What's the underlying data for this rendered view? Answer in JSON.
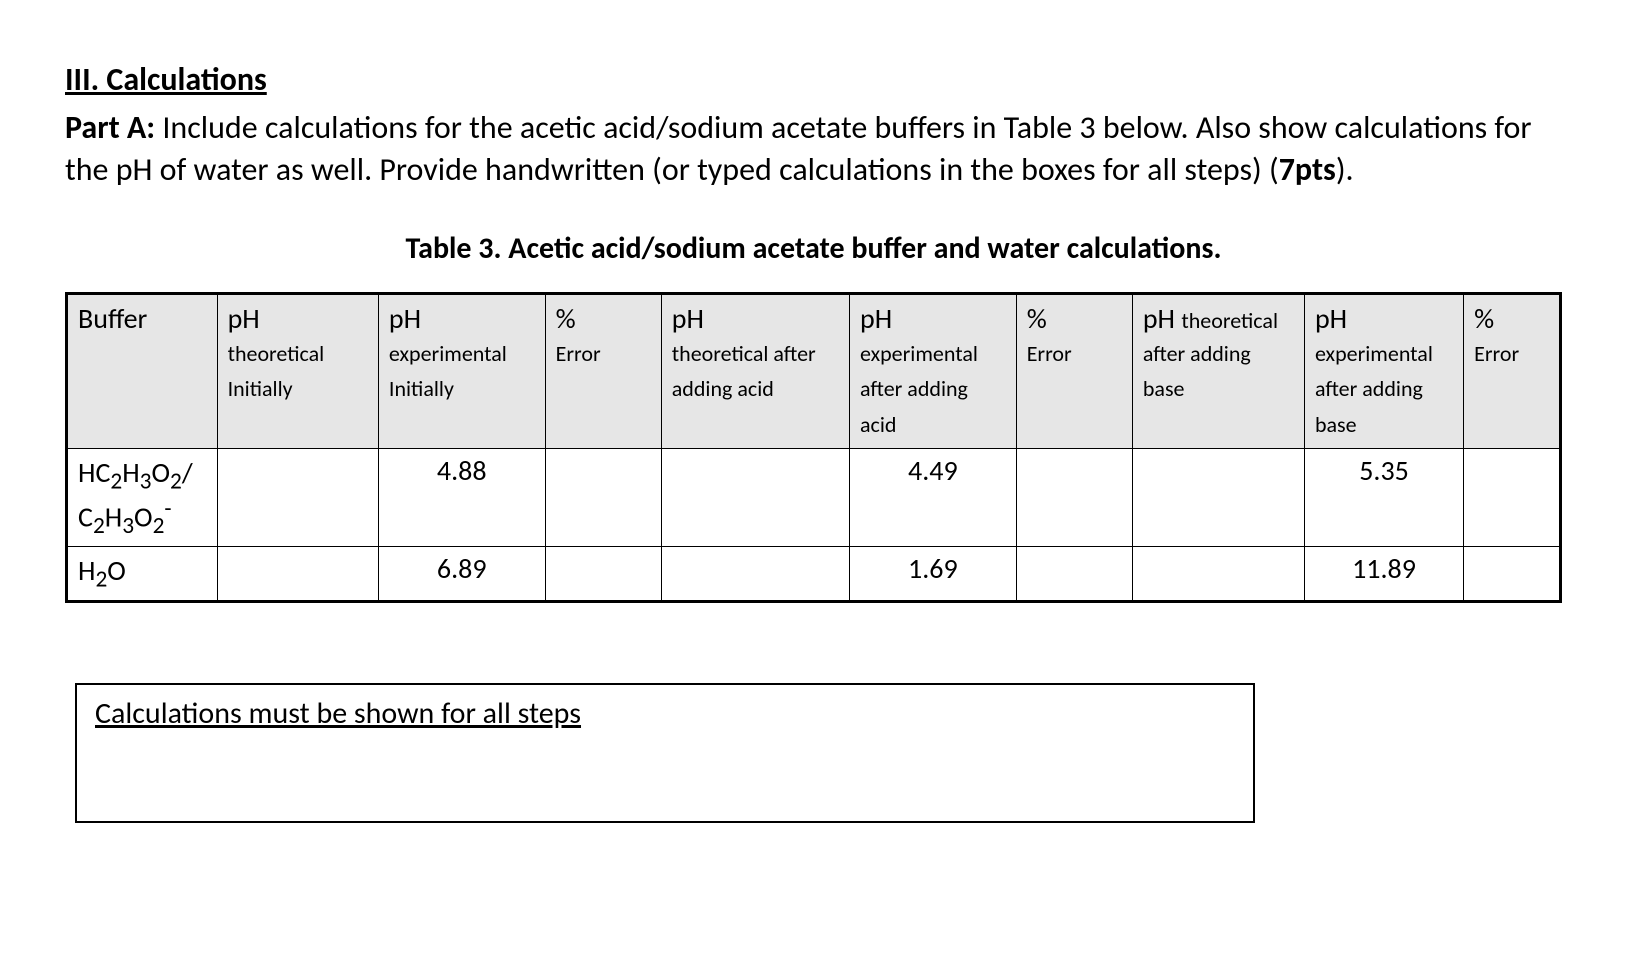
{
  "heading": "III. Calculations",
  "part_a_label": "Part A:",
  "part_a_text1": " Include calculations for the acetic acid/sodium acetate buffers in Table 3 below. Also show calculations for the pH of water as well. Provide handwritten (or typed calculations in the boxes for all steps) (",
  "part_a_pts": "7pts",
  "part_a_text2": ").",
  "table_caption": "Table 3. Acetic acid/sodium acetate buffer and water calculations.",
  "headers": {
    "buffer": {
      "main": "Buffer",
      "sub": ""
    },
    "ph_theo_init": {
      "main": "pH",
      "sub": "theoretical Initially"
    },
    "ph_exp_init": {
      "main": "pH",
      "sub": "experimental Initially"
    },
    "err1": {
      "main": "%",
      "sub": "Error"
    },
    "ph_theo_acid": {
      "main": "pH",
      "sub": "theoretical after adding acid"
    },
    "ph_exp_acid": {
      "main": "pH",
      "sub": "experimental after adding acid"
    },
    "err2": {
      "main": "%",
      "sub": "Error"
    },
    "ph_theo_base": {
      "main_pre": "pH ",
      "main_sub": "theoretical",
      "sub": "after adding base"
    },
    "ph_exp_base": {
      "main": "pH",
      "sub": "experimental after adding base"
    },
    "err3": {
      "main": "%",
      "sub": "Error"
    }
  },
  "chart_data": {
    "type": "table",
    "columns": [
      "Buffer",
      "pH theoretical Initially",
      "pH experimental Initially",
      "% Error",
      "pH theoretical after adding acid",
      "pH experimental after adding acid",
      "% Error",
      "pH theoretical after adding base",
      "pH experimental after adding base",
      "% Error"
    ],
    "rows": [
      {
        "buffer_html": "HC<sub>2</sub>H<sub>3</sub>O<sub>2</sub>/ C<sub>2</sub>H<sub>3</sub>O<sub>2</sub><sup>-</sup>",
        "ph_theo_init": "",
        "ph_exp_init": "4.88",
        "err1": "",
        "ph_theo_acid": "",
        "ph_exp_acid": "4.49",
        "err2": "",
        "ph_theo_base": "",
        "ph_exp_base": "5.35",
        "err3": ""
      },
      {
        "buffer_html": "H<sub>2</sub>O",
        "ph_theo_init": "",
        "ph_exp_init": "6.89",
        "err1": "",
        "ph_theo_acid": "",
        "ph_exp_acid": "1.69",
        "err2": "",
        "ph_theo_base": "",
        "ph_exp_base": "11.89",
        "err3": ""
      }
    ]
  },
  "calc_box_title": "Calculations must be shown for all steps"
}
